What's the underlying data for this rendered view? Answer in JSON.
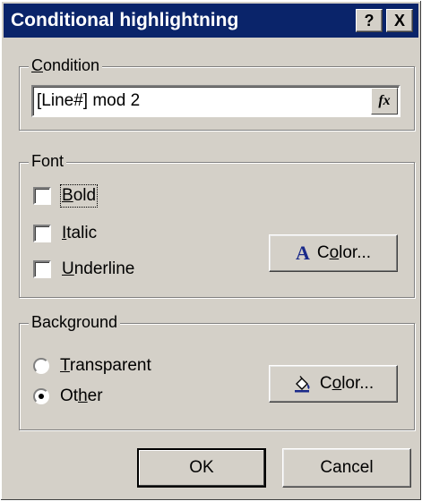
{
  "window": {
    "title": "Conditional highlightning",
    "help_btn": "?",
    "close_btn": "X"
  },
  "condition": {
    "legend": "Condition",
    "value": "[Line#] mod 2",
    "fx_label": "fx"
  },
  "font": {
    "legend": "Font",
    "options": [
      {
        "label": "Bold",
        "checked": false
      },
      {
        "label": "Italic",
        "checked": false
      },
      {
        "label": "Underline",
        "checked": false
      }
    ],
    "color_button": "Color...",
    "color_icon": "font-color-icon",
    "color_icon_glyph": "A"
  },
  "background": {
    "legend": "Background",
    "options": [
      {
        "label": "Transparent",
        "selected": false
      },
      {
        "label": "Other",
        "selected": true
      }
    ],
    "color_button": "Color...",
    "color_icon": "paint-bucket-icon"
  },
  "footer": {
    "ok": "OK",
    "cancel": "Cancel"
  }
}
